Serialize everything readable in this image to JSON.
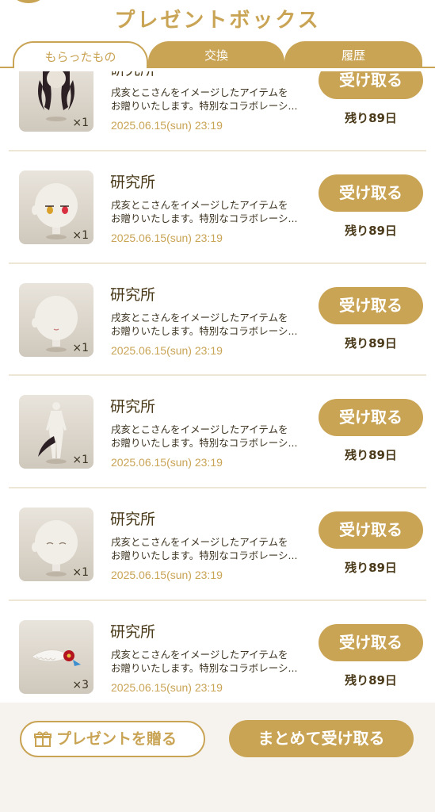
{
  "header": {
    "title": "プレゼントボックス"
  },
  "tabs": [
    {
      "label": "もらったもの",
      "active": true
    },
    {
      "label": "交換",
      "active": false
    },
    {
      "label": "履歴",
      "active": false
    }
  ],
  "items": [
    {
      "name": "研究所",
      "desc1": "戌亥とこさんをイメージしたアイテムを",
      "desc2": "お贈りいたします。特別なコラボレーシ...",
      "date": "2025.06.15(sun) 23:19",
      "qty": "×1",
      "receive": "受け取る",
      "remain": "残り89日",
      "icon": "hair-item-icon"
    },
    {
      "name": "研究所",
      "desc1": "戌亥とこさんをイメージしたアイテムを",
      "desc2": "お贈りいたします。特別なコラボレーシ...",
      "date": "2025.06.15(sun) 23:19",
      "qty": "×1",
      "receive": "受け取る",
      "remain": "残り89日",
      "icon": "eyes-item-icon"
    },
    {
      "name": "研究所",
      "desc1": "戌亥とこさんをイメージしたアイテムを",
      "desc2": "お贈りいたします。特別なコラボレーシ...",
      "date": "2025.06.15(sun) 23:19",
      "qty": "×1",
      "receive": "受け取る",
      "remain": "残り89日",
      "icon": "mouth-item-icon"
    },
    {
      "name": "研究所",
      "desc1": "戌亥とこさんをイメージしたアイテムを",
      "desc2": "お贈りいたします。特別なコラボレーシ...",
      "date": "2025.06.15(sun) 23:19",
      "qty": "×1",
      "receive": "受け取る",
      "remain": "残り89日",
      "icon": "tail-item-icon"
    },
    {
      "name": "研究所",
      "desc1": "戌亥とこさんをイメージしたアイテムを",
      "desc2": "お贈りいたします。特別なコラボレーシ...",
      "date": "2025.06.15(sun) 23:19",
      "qty": "×1",
      "receive": "受け取る",
      "remain": "残り89日",
      "icon": "face-item-icon"
    },
    {
      "name": "研究所",
      "desc1": "戌亥とこさんをイメージしたアイテムを",
      "desc2": "お贈りいたします。特別なコラボレーシ...",
      "date": "2025.06.15(sun) 23:19",
      "qty": "×3",
      "receive": "受け取る",
      "remain": "残り89日",
      "icon": "hair-accessory-item-icon"
    }
  ],
  "footer": {
    "send_label": "プレゼントを贈る",
    "receive_all_label": "まとめて受け取る"
  },
  "colors": {
    "accent": "#c9a455",
    "footer_bg": "#f6f2ed",
    "separator": "#efe7d6"
  }
}
